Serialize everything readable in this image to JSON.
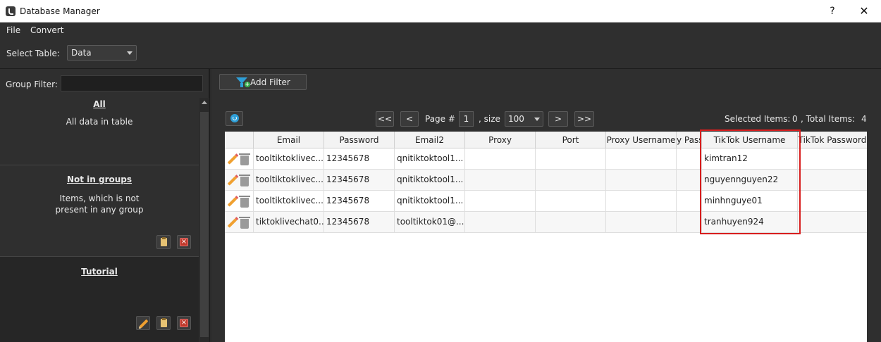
{
  "window": {
    "title": "Database Manager",
    "help": "?",
    "close": "✕"
  },
  "menu": {
    "file": "File",
    "convert": "Convert"
  },
  "select_table": {
    "label": "Select Table:",
    "value": "Data"
  },
  "group_filter": {
    "label": "Group Filter:",
    "value": ""
  },
  "groups": [
    {
      "title": "All",
      "desc": "All data in table"
    },
    {
      "title": "Not in groups",
      "desc_line1": "Items, which is not",
      "desc_line2": "present in any group"
    },
    {
      "title": "Tutorial"
    }
  ],
  "toolbar": {
    "add_filter": "Add Filter"
  },
  "pagination": {
    "first": "<<",
    "prev": "<",
    "page_label": "Page #",
    "page": "1",
    "size_label": ", size",
    "size": "100",
    "next": ">",
    "last": ">>"
  },
  "summary": {
    "selected_label": "Selected Items:",
    "selected": "0",
    "total_label": ", Total Items:",
    "total": "4"
  },
  "table": {
    "columns": [
      "Email",
      "Password",
      "Email2",
      "Proxy",
      "Port",
      "Proxy Username",
      "y Pass",
      "TikTok Username",
      "TikTok Password"
    ],
    "rows": [
      [
        "tooltiktoklivec...",
        "12345678",
        "qnitiktoktool1...",
        "",
        "",
        "",
        "",
        "kimtran12",
        ""
      ],
      [
        "tooltiktoklivec...",
        "12345678",
        "qnitiktoktool1...",
        "",
        "",
        "",
        "",
        "nguyennguyen22",
        ""
      ],
      [
        "tooltiktoklivec...",
        "12345678",
        "qnitiktoktool1...",
        "",
        "",
        "",
        "",
        "minhnguye01",
        ""
      ],
      [
        "tiktoklivechat0...",
        "12345678",
        "tooltiktok01@...",
        "",
        "",
        "",
        "",
        "tranhuyen924",
        ""
      ]
    ]
  },
  "colors": {
    "highlight": "#d81e1e",
    "accent": "#2e9fd8",
    "background": "#2b2b2b"
  }
}
